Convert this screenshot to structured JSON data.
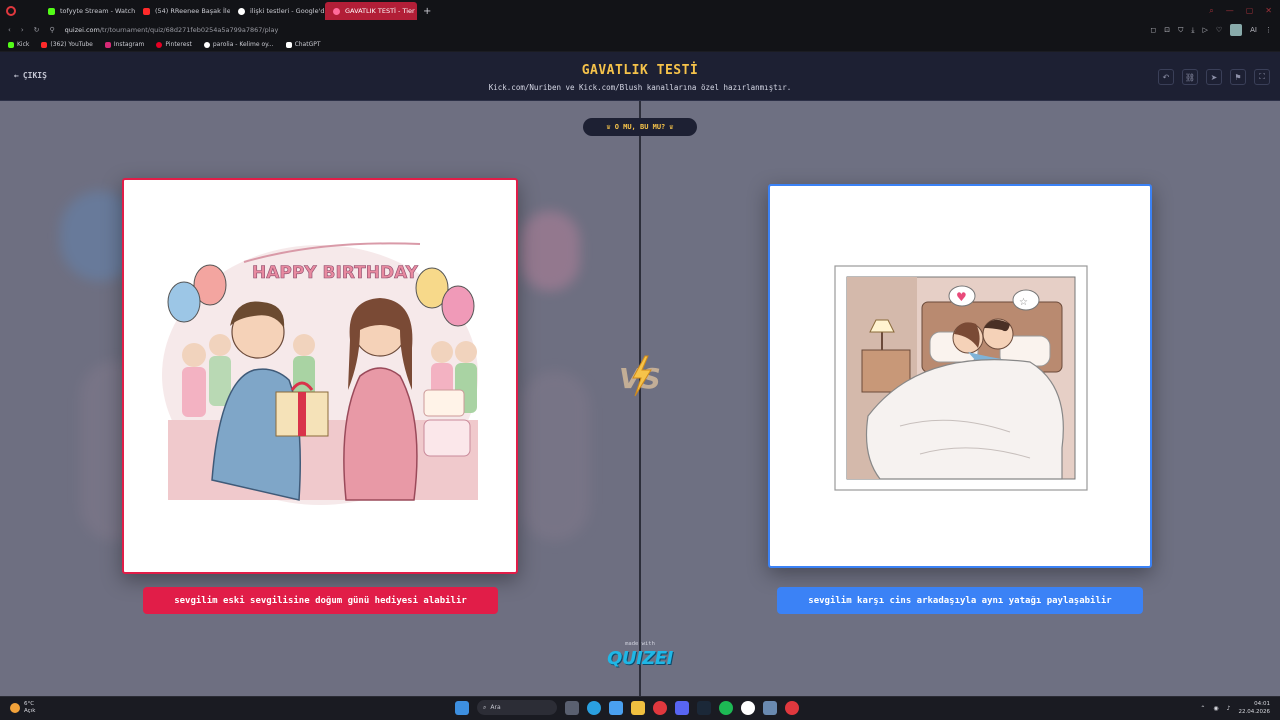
{
  "browser": {
    "tabs": [
      {
        "label": "tofyyte Stream - Watch Li",
        "color": "#53fc18"
      },
      {
        "label": "(54) RReenee Başak İle G",
        "color": "#ff2a2a"
      },
      {
        "label": "ilişki testleri - Google'da A",
        "color": "#ffffff"
      },
      {
        "label": "GAVATLIK TESTİ - Tier Lis",
        "color": "#ff6b9a",
        "active": true
      }
    ],
    "url_prefix": "quizei.com",
    "url_path": "/tr/tournament/quiz/68d271feb0254a5a799a7867/play",
    "bookmarks": [
      {
        "label": "Kick",
        "color": "#53fc18"
      },
      {
        "label": "(362) YouTube",
        "color": "#ff2a2a"
      },
      {
        "label": "Instagram",
        "color": "#d62976"
      },
      {
        "label": "Pinterest",
        "color": "#e60023"
      },
      {
        "label": "parolia - Kelime oy...",
        "color": "#ffffff"
      },
      {
        "label": "ChatGPT",
        "color": "#ffffff"
      }
    ],
    "addr_right_label": "AI"
  },
  "header": {
    "exit_label": "ÇIKIŞ",
    "title": "GAVATLIK TESTİ",
    "subtitle": "Kick.com/Nuriben ve Kick.com/Blush kanallarına özel hazırlanmıştır."
  },
  "pill_label": "O MU, BU MU?",
  "left_choice": {
    "label": "sevgilim eski sevgilisine doğum günü hediyesi alabilir",
    "banner_text": "HAPPY BIRTHDAY"
  },
  "right_choice": {
    "label": "sevgilim karşı cins arkadaşıyla aynı yatağı paylaşabilir"
  },
  "footer": {
    "made_with": "made with",
    "brand": "QUIZEI"
  },
  "taskbar": {
    "temp": "6°C",
    "weather": "Açık",
    "search_placeholder": "Ara",
    "time": "04:01",
    "date": "22.04.2026"
  },
  "colors": {
    "accent_red": "#e11d48",
    "accent_blue": "#3b82f6",
    "title_yellow": "#f6c34a"
  }
}
